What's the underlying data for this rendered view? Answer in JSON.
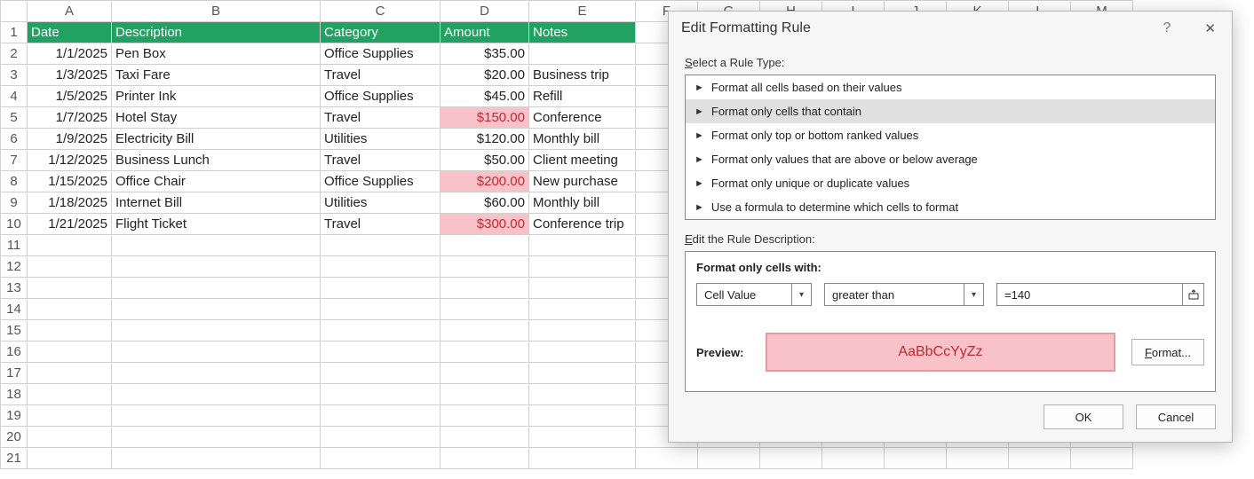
{
  "columns": [
    "A",
    "B",
    "C",
    "D",
    "E",
    "F",
    "G",
    "H",
    "I",
    "J",
    "K",
    "L",
    "M"
  ],
  "headers": {
    "A": "Date",
    "B": "Description",
    "C": "Category",
    "D": "Amount",
    "E": "Notes"
  },
  "rows": [
    {
      "date": "1/1/2025",
      "desc": "Pen Box",
      "cat": "Office Supplies",
      "amt": "$35.00",
      "notes": "",
      "hl": false
    },
    {
      "date": "1/3/2025",
      "desc": "Taxi Fare",
      "cat": "Travel",
      "amt": "$20.00",
      "notes": "Business trip",
      "hl": false
    },
    {
      "date": "1/5/2025",
      "desc": "Printer Ink",
      "cat": "Office Supplies",
      "amt": "$45.00",
      "notes": "Refill",
      "hl": false
    },
    {
      "date": "1/7/2025",
      "desc": "Hotel Stay",
      "cat": "Travel",
      "amt": "$150.00",
      "notes": "Conference",
      "hl": true
    },
    {
      "date": "1/9/2025",
      "desc": "Electricity Bill",
      "cat": "Utilities",
      "amt": "$120.00",
      "notes": "Monthly bill",
      "hl": false
    },
    {
      "date": "1/12/2025",
      "desc": "Business Lunch",
      "cat": "Travel",
      "amt": "$50.00",
      "notes": "Client meeting",
      "hl": false
    },
    {
      "date": "1/15/2025",
      "desc": "Office Chair",
      "cat": "Office Supplies",
      "amt": "$200.00",
      "notes": "New purchase",
      "hl": true
    },
    {
      "date": "1/18/2025",
      "desc": "Internet Bill",
      "cat": "Utilities",
      "amt": "$60.00",
      "notes": "Monthly bill",
      "hl": false
    },
    {
      "date": "1/21/2025",
      "desc": "Flight Ticket",
      "cat": "Travel",
      "amt": "$300.00",
      "notes": "Conference trip",
      "hl": true
    }
  ],
  "totalRows": 21,
  "dialog": {
    "title": "Edit Formatting Rule",
    "selectLabel": "Select a Rule Type:",
    "rules": [
      "Format all cells based on their values",
      "Format only cells that contain",
      "Format only top or bottom ranked values",
      "Format only values that are above or below average",
      "Format only unique or duplicate values",
      "Use a formula to determine which cells to format"
    ],
    "selectedRuleIndex": 1,
    "editLabel": "Edit the Rule Description:",
    "formatOnly": "Format only cells with:",
    "combo1": "Cell Value",
    "combo2": "greater than",
    "valueInput": "=140",
    "previewLabel": "Preview:",
    "previewText": "AaBbCcYyZz",
    "formatBtnPrefix": "F",
    "formatBtnRest": "ormat...",
    "ok": "OK",
    "cancel": "Cancel"
  }
}
